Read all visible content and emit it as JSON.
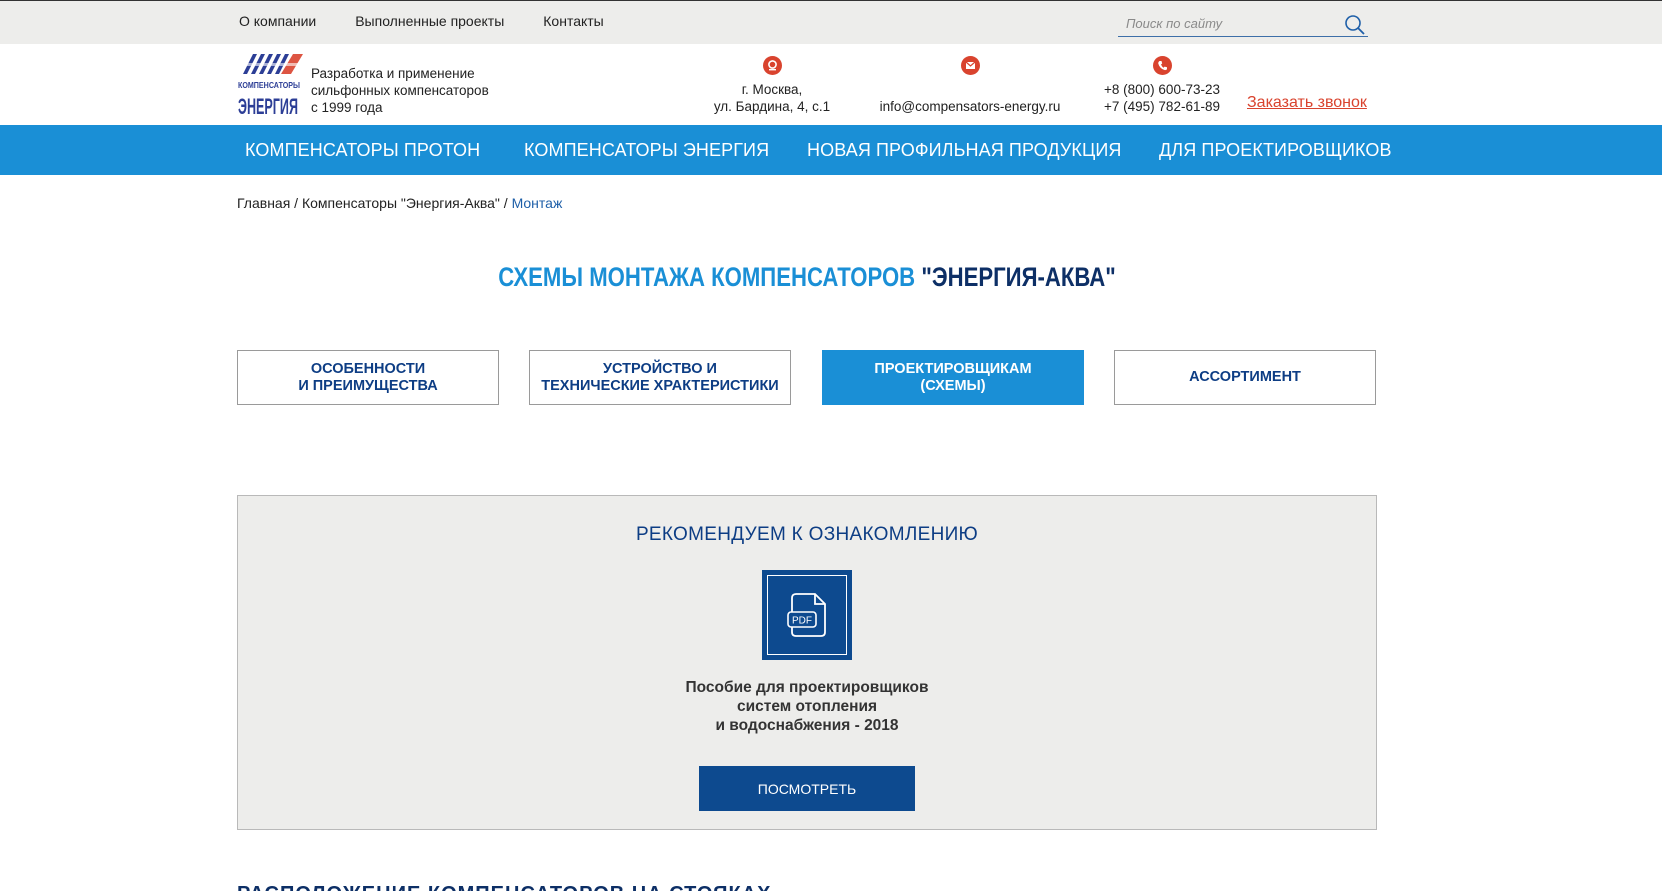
{
  "topnav": {
    "items": [
      "О компании",
      "Выполненные проекты",
      "Контакты"
    ]
  },
  "search": {
    "placeholder": "Поиск по сайту"
  },
  "brand": {
    "logo_text_top": "КОМПЕНСАТОРЫ",
    "logo_text_bottom": "ЭНЕРГИЯ",
    "tagline": [
      "Разработка и применение",
      "сильфонных компенсаторов",
      "с 1999 года"
    ]
  },
  "contacts": {
    "address": [
      "г. Москва,",
      "ул. Бардина, 4, с.1"
    ],
    "email": "info@compensators-energy.ru",
    "phones": [
      "+8 (800) 600-73-23",
      "+7 (495) 782-61-89"
    ],
    "callback": "Заказать звонок"
  },
  "mainnav": {
    "items": [
      "КОМПЕНСАТОРЫ ПРОТОН",
      "КОМПЕНСАТОРЫ ЭНЕРГИЯ",
      "НОВАЯ ПРОФИЛЬНАЯ ПРОДУКЦИЯ",
      "ДЛЯ ПРОЕКТИРОВЩИКОВ"
    ]
  },
  "breadcrumb": {
    "home": "Главная",
    "section": "Компенсаторы \"Энергия-Аква\"",
    "current": "Монтаж",
    "sep": " / "
  },
  "page": {
    "title_main": "СХЕМЫ МОНТАЖА КОМПЕНСАТОРОВ",
    "title_accent": "\"ЭНЕРГИЯ-АКВА\""
  },
  "tabs": [
    {
      "line1": "ОСОБЕННОСТИ",
      "line2": "И ПРЕИМУЩЕСТВА",
      "active": false
    },
    {
      "line1": "УСТРОЙСТВО И",
      "line2": "ТЕХНИЧЕСКИЕ ХРАКТЕРИСТИКИ",
      "active": false
    },
    {
      "line1": "ПРОЕКТИРОВЩИКАМ",
      "line2": "(СХЕМЫ)",
      "active": true
    },
    {
      "line1": "АССОРТИМЕНТ",
      "line2": "",
      "active": false
    }
  ],
  "recommend": {
    "title": "РЕКОМЕНДУЕМ К ОЗНАКОМЛЕНИЮ",
    "file_label": "PDF",
    "doc_title": [
      "Пособие для проектировщиков",
      "систем отопления",
      "и водоснабжения - 2018"
    ],
    "button": "ПОСМОТРЕТЬ"
  },
  "next_section": {
    "title": "РАСПОЛОЖЕНИЕ КОМПЕНСАТОРОВ НА СТОЯКАХ"
  },
  "colors": {
    "nav_blue": "#1a8fd6",
    "dark_blue": "#0d4a8f",
    "accent_red": "#d9432e",
    "panel_gray": "#ededeb"
  },
  "icons": [
    "search-icon",
    "location-icon",
    "mail-icon",
    "phone-icon",
    "pdf-file-icon"
  ]
}
